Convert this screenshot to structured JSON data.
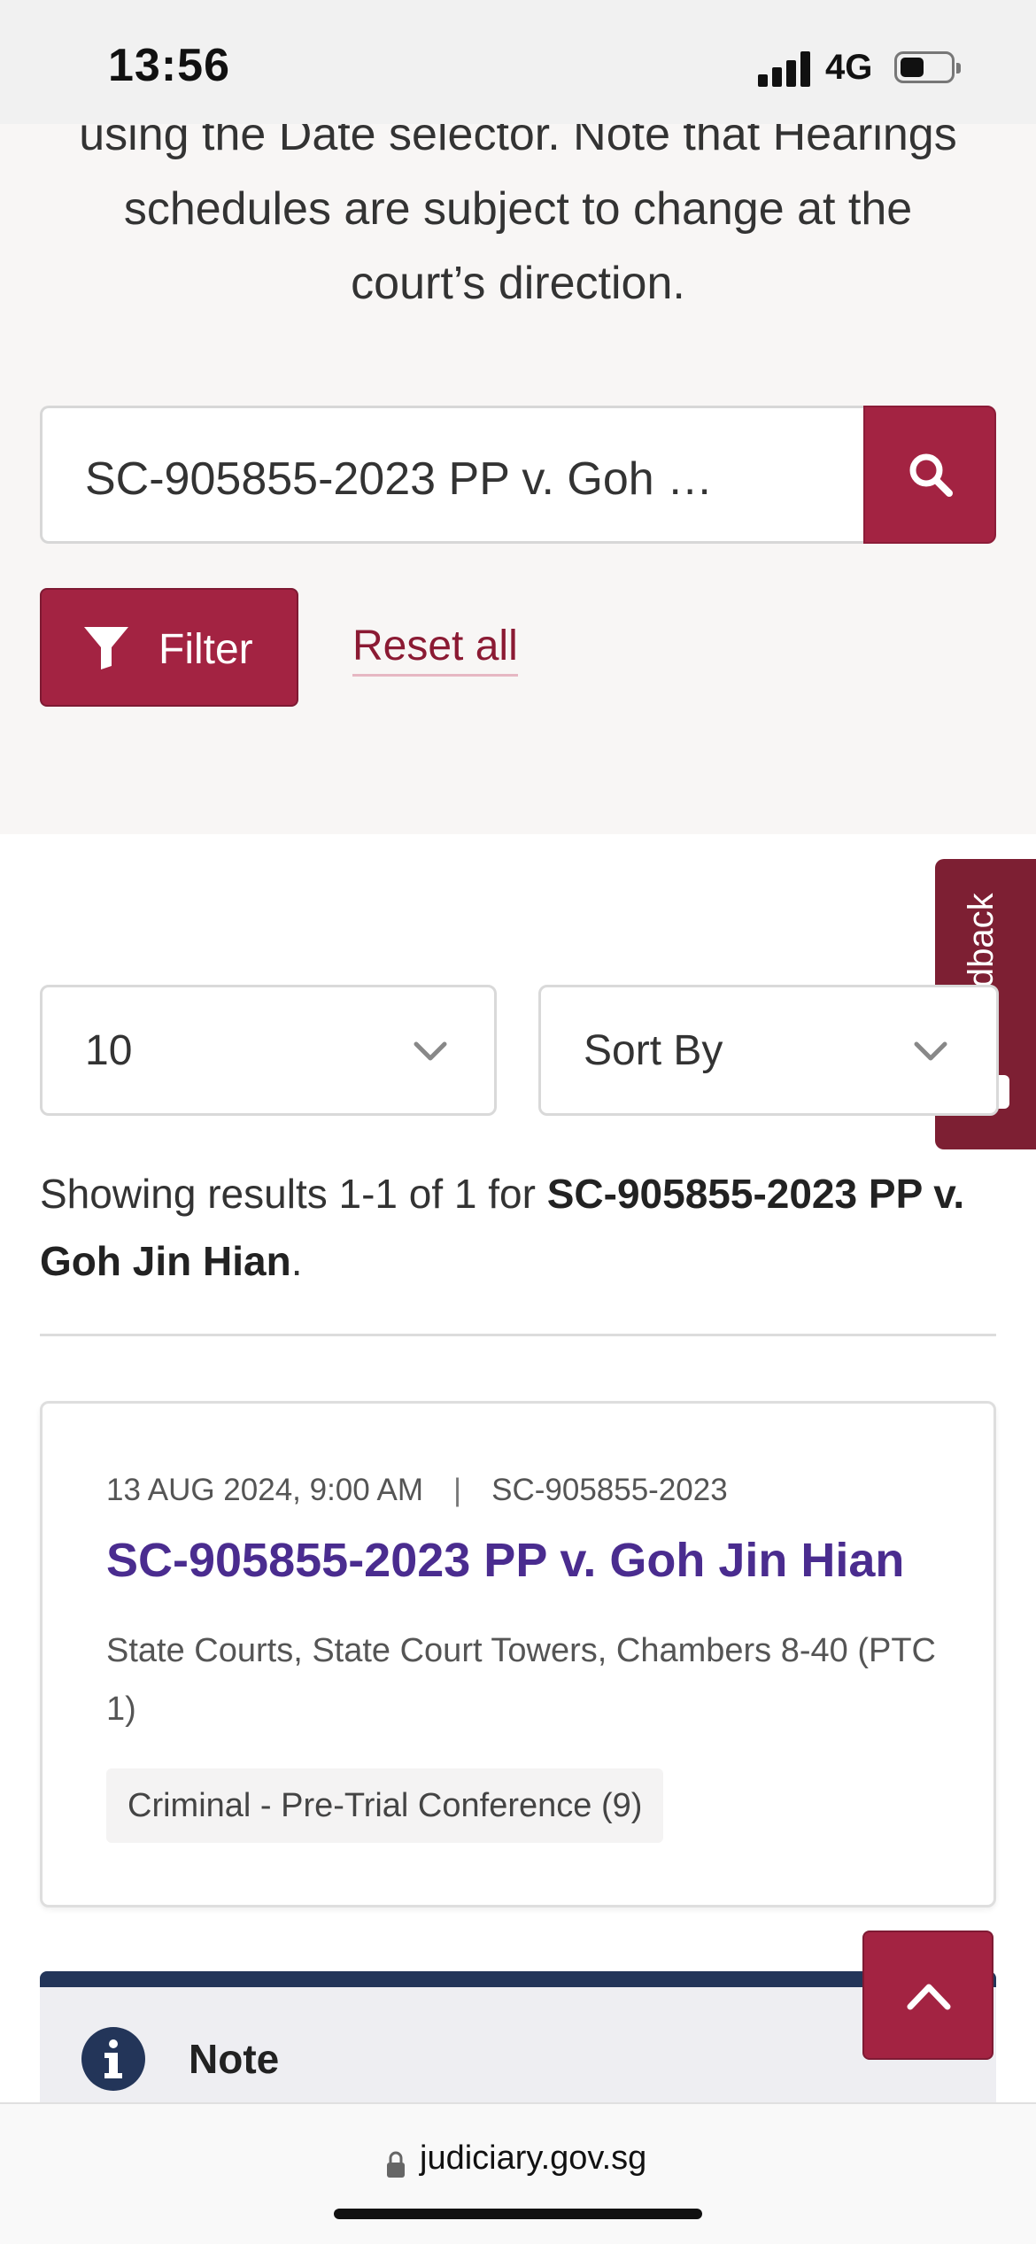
{
  "status_bar": {
    "time": "13:56",
    "network": "4G"
  },
  "intro_text": "using the Date selector. Note that Hearings schedules are subject to change at the court’s direction.",
  "search": {
    "value": "SC-905855-2023 PP v. Goh Jin Hian",
    "button_icon": "search-icon"
  },
  "filter": {
    "label": "Filter",
    "icon": "filter-icon"
  },
  "reset_label": "Reset all",
  "feedback_label": "Feedback",
  "page_size": {
    "value": "10"
  },
  "sort": {
    "label": "Sort By"
  },
  "results": {
    "prefix": "Showing results 1-1 of 1 for ",
    "query": "SC-905855-2023 PP v. Goh Jin Hian",
    "suffix": "."
  },
  "hearing": {
    "datetime": "13 AUG 2024, 9:00 AM",
    "separator": "|",
    "case_no": "SC-905855-2023",
    "title": "SC-905855-2023 PP v. Goh Jin Hian",
    "location": "State Courts, State Court Towers, Chambers 8-40 (PTC 1)",
    "tag": "Criminal - Pre-Trial Conference (9)"
  },
  "note": {
    "title": "Note"
  },
  "browser": {
    "domain": "judiciary.gov.sg"
  },
  "colors": {
    "brand": "#a32342",
    "title_link": "#4a2c8f",
    "note_bar": "#233559",
    "feedback_tab": "#7d1f33"
  }
}
